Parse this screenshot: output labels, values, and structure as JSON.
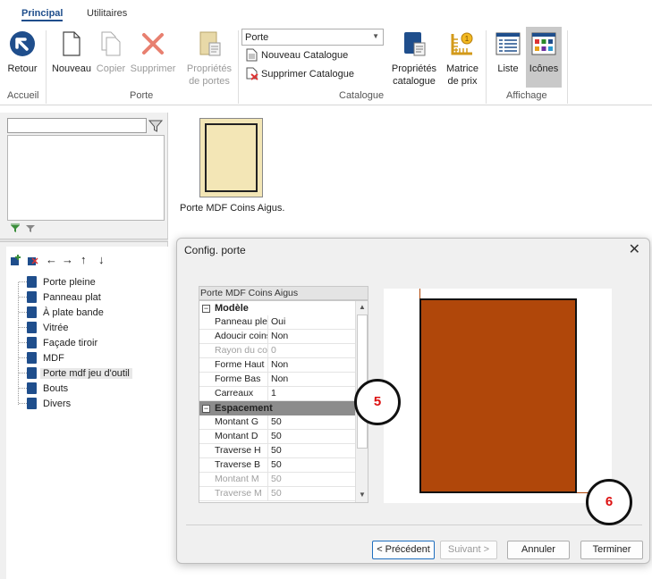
{
  "tabs": {
    "principal": "Principal",
    "utilitaires": "Utilitaires"
  },
  "ribbon": {
    "retour": "Retour",
    "nouveau": "Nouveau",
    "copier": "Copier",
    "supprimer": "Supprimer",
    "proprietes_portes_1": "Propriétés",
    "proprietes_portes_2": "de portes",
    "catalogue_select": "Porte",
    "nouveau_catalogue": "Nouveau Catalogue",
    "supprimer_catalogue": "Supprimer Catalogue",
    "proprietes_catalogue_1": "Propriétés",
    "proprietes_catalogue_2": "catalogue",
    "matrice_1": "Matrice",
    "matrice_2": "de prix",
    "liste": "Liste",
    "icones": "Icônes",
    "groups": {
      "accueil": "Accueil",
      "porte": "Porte",
      "catalogue": "Catalogue",
      "affichage": "Affichage"
    }
  },
  "tree": {
    "items": [
      "Porte pleine",
      "Panneau plat",
      "À plate bande",
      "Vitrée",
      "Façade tiroir",
      "MDF",
      "Porte mdf jeu d'outil",
      "Bouts",
      "Divers"
    ]
  },
  "gallery": {
    "item_label": "Porte MDF Coins Aigus."
  },
  "dialog": {
    "title": "Config. porte",
    "grid_header": "Porte MDF Coins Aigus",
    "cat_modele": "Modèle",
    "cat_espacement": "Espacement",
    "rows_modele": [
      {
        "k": "Panneau plein",
        "v": "Oui"
      },
      {
        "k": "Adoucir coins",
        "v": "Non"
      },
      {
        "k": "Rayon du coin",
        "v": "0"
      },
      {
        "k": "Forme Haut",
        "v": "Non"
      },
      {
        "k": "Forme Bas",
        "v": "Non"
      },
      {
        "k": "Carreaux",
        "v": "1"
      }
    ],
    "rows_espacement": [
      {
        "k": "Montant G",
        "v": "50"
      },
      {
        "k": "Montant D",
        "v": "50"
      },
      {
        "k": "Traverse H",
        "v": "50"
      },
      {
        "k": "Traverse B",
        "v": "50"
      },
      {
        "k": "Montant M",
        "v": "50"
      },
      {
        "k": "Traverse M",
        "v": "50"
      }
    ],
    "btn_prev": "< Précédent",
    "btn_next": "Suivant >",
    "btn_cancel": "Annuler",
    "btn_finish": "Terminer"
  },
  "annotations": {
    "circle5": "5",
    "circle6": "6"
  },
  "colors": {
    "accent": "#1f4e8c",
    "door_fill": "#b0470a",
    "door_thumb": "#f3e6b6"
  }
}
